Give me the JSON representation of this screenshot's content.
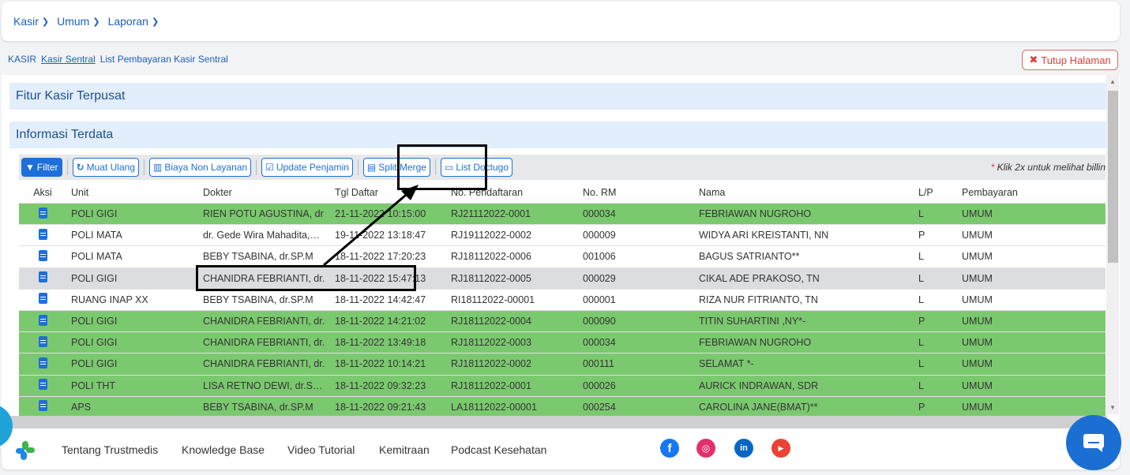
{
  "menus": [
    {
      "label": "Kasir"
    },
    {
      "label": "Umum"
    },
    {
      "label": "Laporan"
    }
  ],
  "breadcrumb": {
    "root": "KASIR",
    "current": "Kasir Sentral",
    "page": "List Pembayaran Kasir Sentral"
  },
  "close_button": "Tutup Halaman",
  "sections": {
    "fitur": "Fitur Kasir Terpusat",
    "info": "Informasi Terdata"
  },
  "toolbar": {
    "filter": "Filter",
    "muat_ulang": "Muat Ulang",
    "biaya_non_layanan": "Biaya Non Layanan",
    "update_penjamin": "Update Penjamin",
    "split_merge": "Split/Merge",
    "list_doctugo": "List Doctugo",
    "hint": "Klik 2x untuk melihat billin"
  },
  "table": {
    "headers": [
      "Aksi",
      "Unit",
      "Dokter",
      "Tgl Daftar",
      "No. Pendaftaran",
      "No. RM",
      "Nama",
      "L/P",
      "Pembayaran"
    ],
    "rows": [
      {
        "style": "green",
        "unit": "POLI GIGI",
        "dokter": "RIEN POTU AGUSTINA, dr",
        "tgl": "21-11-2022 10:15:00",
        "nodaftar": "RJ21112022-0001",
        "norm": "000034",
        "nama": "FEBRIAWAN NUGROHO",
        "lp": "L",
        "bayar": "UMUM"
      },
      {
        "style": "white",
        "unit": "POLI MATA",
        "dokter": "dr. Gede Wira Mahadita,…",
        "tgl": "19-11-2022 13:18:47",
        "nodaftar": "RJ19112022-0002",
        "norm": "000009",
        "nama": "WIDYA ARI KREISTANTI, NN",
        "lp": "P",
        "bayar": "UMUM"
      },
      {
        "style": "white",
        "unit": "POLI MATA",
        "dokter": "BEBY TSABINA, dr.SP.M",
        "tgl": "18-11-2022 17:20:23",
        "nodaftar": "RJ18112022-0006",
        "norm": "001006",
        "nama": "BAGUS SATRIANTO**",
        "lp": "L",
        "bayar": "UMUM"
      },
      {
        "style": "gray",
        "unit": "POLI GIGI",
        "dokter": "CHANIDRA FEBRIANTI, dr.",
        "tgl": "18-11-2022 15:47:13",
        "nodaftar": "RJ18112022-0005",
        "norm": "000029",
        "nama": "CIKAL ADE PRAKOSO, TN",
        "lp": "L",
        "bayar": "UMUM"
      },
      {
        "style": "white",
        "unit": "RUANG INAP XX",
        "dokter": "BEBY TSABINA, dr.SP.M",
        "tgl": "18-11-2022 14:42:47",
        "nodaftar": "RI18112022-00001",
        "norm": "000001",
        "nama": "RIZA NUR FITRIANTO, TN",
        "lp": "L",
        "bayar": "UMUM"
      },
      {
        "style": "green",
        "unit": "POLI GIGI",
        "dokter": "CHANIDRA FEBRIANTI, dr.",
        "tgl": "18-11-2022 14:21:02",
        "nodaftar": "RJ18112022-0004",
        "norm": "000090",
        "nama": "TITIN SUHARTINI ,NY*-",
        "lp": "P",
        "bayar": "UMUM"
      },
      {
        "style": "green",
        "unit": "POLI GIGI",
        "dokter": "CHANIDRA FEBRIANTI, dr.",
        "tgl": "18-11-2022 13:49:18",
        "nodaftar": "RJ18112022-0003",
        "norm": "000034",
        "nama": "FEBRIAWAN NUGROHO",
        "lp": "L",
        "bayar": "UMUM"
      },
      {
        "style": "green",
        "unit": "POLI GIGI",
        "dokter": "CHANIDRA FEBRIANTI, dr.",
        "tgl": "18-11-2022 10:14:21",
        "nodaftar": "RJ18112022-0002",
        "norm": "000111",
        "nama": "SELAMAT *-",
        "lp": "L",
        "bayar": "UMUM"
      },
      {
        "style": "green",
        "unit": "POLI THT",
        "dokter": "LISA RETNO DEWI, dr.S…",
        "tgl": "18-11-2022 09:32:23",
        "nodaftar": "RJ18112022-0001",
        "norm": "000026",
        "nama": "AURICK INDRAWAN, SDR",
        "lp": "L",
        "bayar": "UMUM"
      },
      {
        "style": "green",
        "unit": "APS",
        "dokter": "BEBY TSABINA, dr.SP.M",
        "tgl": "18-11-2022 09:21:43",
        "nodaftar": "LA18112022-00001",
        "norm": "000254",
        "nama": "CAROLINA JANE(BMAT)**",
        "lp": "P",
        "bayar": "UMUM"
      }
    ]
  },
  "footer": {
    "links": [
      "Tentang Trustmedis",
      "Knowledge Base",
      "Video Tutorial",
      "Kemitraan",
      "Podcast Kesehatan"
    ],
    "social": [
      "facebook-icon",
      "instagram-icon",
      "linkedin-icon",
      "youtube-icon"
    ]
  },
  "colors": {
    "accent": "#1e6fd9",
    "row_green": "#7bc96f",
    "row_gray": "#dcdde0",
    "danger": "#e03c3c"
  }
}
